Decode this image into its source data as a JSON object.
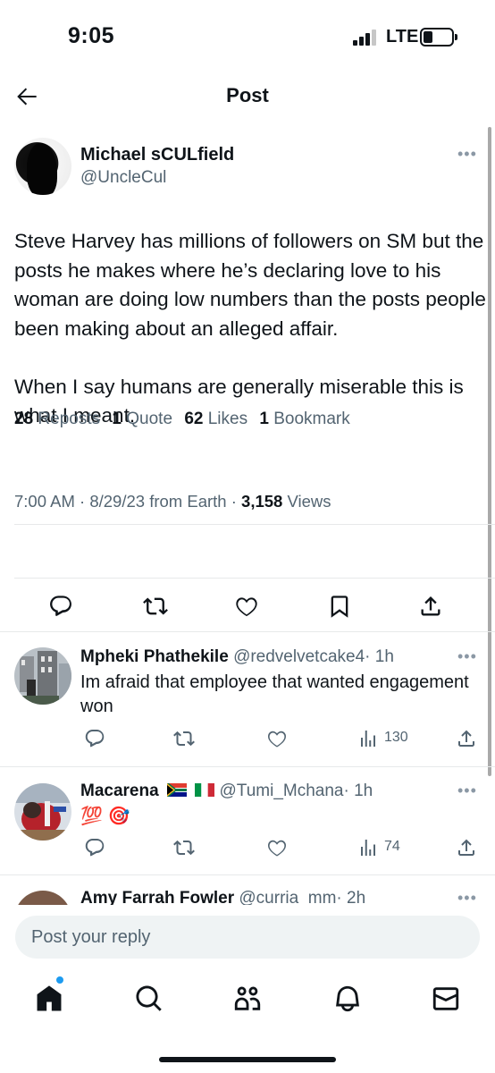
{
  "status_bar": {
    "time": "9:05",
    "network": "LTE"
  },
  "header": {
    "title": "Post"
  },
  "main_tweet": {
    "author_name": "Michael sCULfield",
    "author_handle": "@UncleCul",
    "more_label": "•••",
    "text": "Steve Harvey has millions of followers on SM but the posts he makes where he’s declaring love to his woman are doing low numbers than the posts people been making about an alleged affair.\n\nWhen I say humans are generally miserable this is what I meant.",
    "time": "7:00 AM",
    "date": "8/29/23",
    "source": "from Earth",
    "separator": " · ",
    "views_count": "3,158",
    "views_label": "Views",
    "stats": {
      "reposts_count": "28",
      "reposts_label": "Reposts",
      "quotes_count": "1",
      "quotes_label": "Quote",
      "likes_count": "62",
      "likes_label": "Likes",
      "bookmarks_count": "1",
      "bookmarks_label": "Bookmark"
    },
    "action_icons": [
      "reply-icon",
      "repost-icon",
      "like-icon",
      "bookmark-icon",
      "share-icon"
    ]
  },
  "replies": [
    {
      "name": "Mpheki Phathekile",
      "handle": "@redvelvetcake4",
      "time": "· 1h",
      "text": "Im afraid that employee  that wanted engagement won",
      "views": "130",
      "more_label": "•••"
    },
    {
      "name": "Macarena",
      "handle": "@Tumi_Mchana",
      "time": "· 1h",
      "text": "💯 🎯",
      "views": "74",
      "more_label": "•••",
      "flags": [
        "south-africa-flag",
        "italy-flag"
      ]
    },
    {
      "name": "Amy Farrah Fowler",
      "handle": "@curria_mm",
      "time": "· 2h",
      "more_label": "•••"
    }
  ],
  "composer": {
    "placeholder": "Post your reply"
  },
  "bottom_nav": {
    "items": [
      "home-icon",
      "search-icon",
      "communities-icon",
      "notifications-icon",
      "messages-icon"
    ],
    "badge_color": "#1d9bf0"
  },
  "colors": {
    "text": "#0f1419",
    "secondary": "#536471",
    "divider": "#e7e9ea",
    "accent": "#1d9bf0"
  }
}
